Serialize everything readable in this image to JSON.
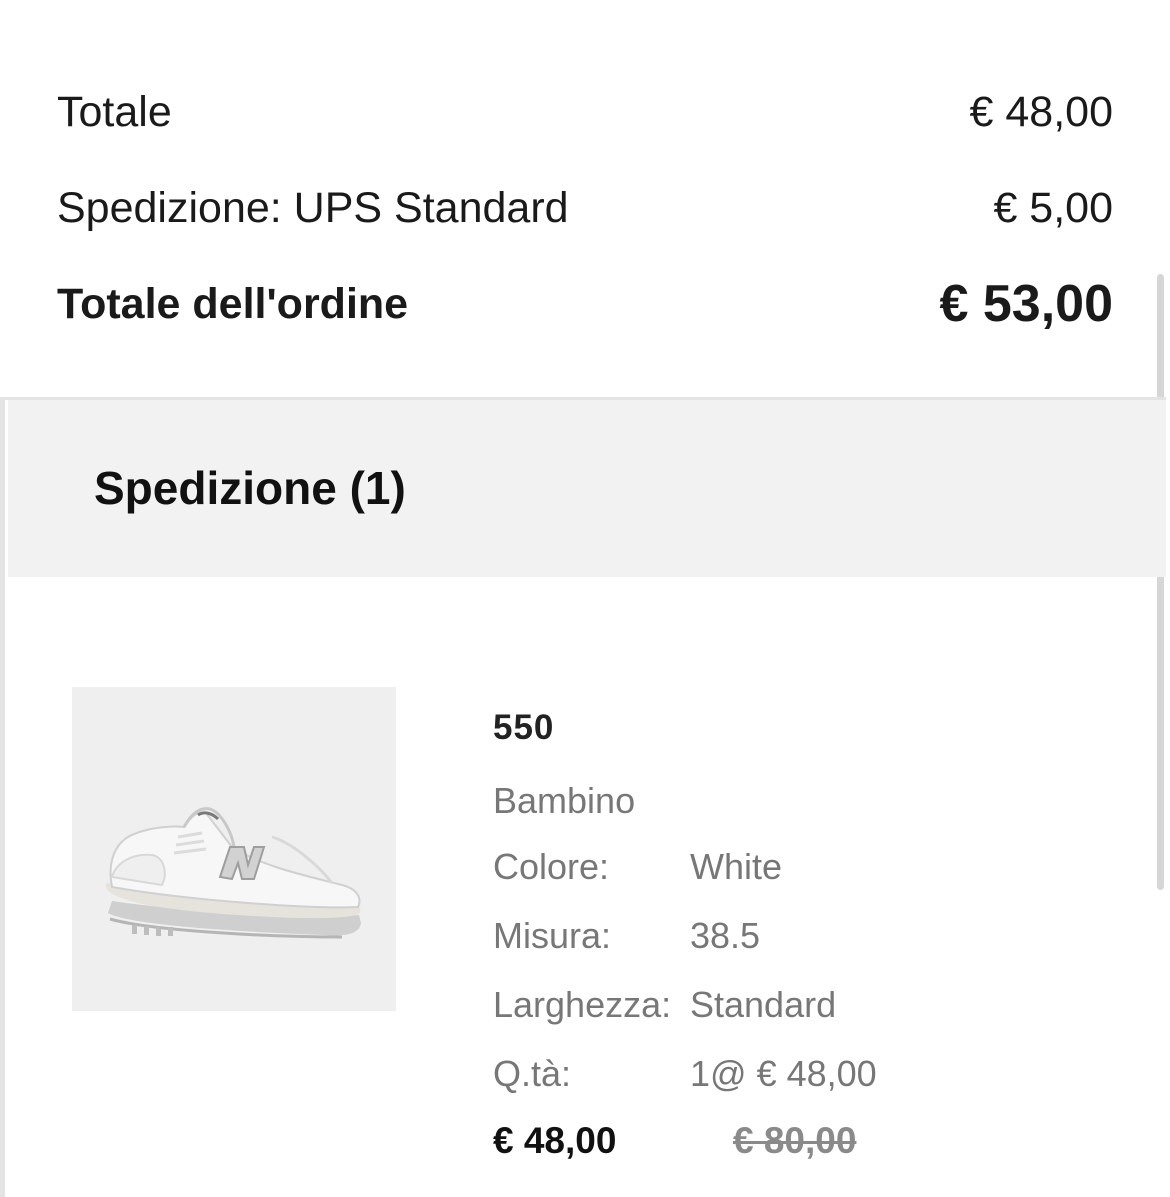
{
  "summary": {
    "subtotal_label": "Totale",
    "subtotal_value": "€ 48,00",
    "shipping_label": "Spedizione: UPS Standard",
    "shipping_value": "€ 5,00",
    "order_total_label": "Totale dell'ordine",
    "order_total_value": "€ 53,00"
  },
  "shipment": {
    "title": "Spedizione (1)",
    "item": {
      "image_icon": "sneaker-product-image",
      "name": "550",
      "category": "Bambino",
      "color_label": "Colore:",
      "color_value": "White",
      "size_label": "Misura:",
      "size_value": "38.5",
      "width_label": "Larghezza:",
      "width_value": "Standard",
      "qty_label": "Q.tà:",
      "qty_value": "1@ € 48,00",
      "price": "€ 48,00",
      "original_price": "€ 80,00"
    }
  },
  "colors": {
    "text_primary": "#111111",
    "text_secondary": "#777777",
    "section_bg": "#f2f2f2"
  }
}
